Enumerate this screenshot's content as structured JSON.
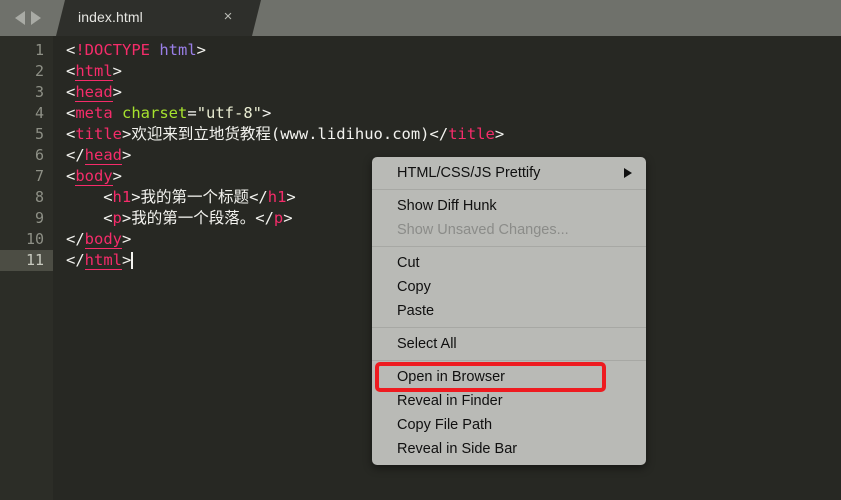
{
  "window": {
    "background_color": "#2b2b28"
  },
  "tabbar": {
    "nav_back_icon": "triangle-left-icon",
    "nav_forward_icon": "triangle-right-icon",
    "tab_title": "index.html",
    "close_icon": "×"
  },
  "editor": {
    "background_color": "#272823",
    "gutter_color": "#2c2d27",
    "active_line": 11,
    "line_numbers": [
      "1",
      "2",
      "3",
      "4",
      "5",
      "6",
      "7",
      "8",
      "9",
      "10",
      "11"
    ],
    "lines": [
      {
        "n": "1",
        "tokens": [
          {
            "t": "<",
            "c": "punc"
          },
          {
            "t": "!DOCTYPE",
            "c": "doct"
          },
          {
            "t": " ",
            "c": "punc"
          },
          {
            "t": "html",
            "c": "kw"
          },
          {
            "t": ">",
            "c": "punc"
          }
        ]
      },
      {
        "n": "2",
        "tokens": [
          {
            "t": "<",
            "c": "punc"
          },
          {
            "t": "html",
            "c": "tag-u"
          },
          {
            "t": ">",
            "c": "punc"
          }
        ]
      },
      {
        "n": "3",
        "tokens": [
          {
            "t": "<",
            "c": "punc"
          },
          {
            "t": "head",
            "c": "tag-u"
          },
          {
            "t": ">",
            "c": "punc"
          }
        ]
      },
      {
        "n": "4",
        "tokens": [
          {
            "t": "<",
            "c": "punc"
          },
          {
            "t": "meta",
            "c": "tag"
          },
          {
            "t": " ",
            "c": "punc"
          },
          {
            "t": "charset",
            "c": "attr"
          },
          {
            "t": "=",
            "c": "punc"
          },
          {
            "t": "\"utf-8\"",
            "c": "str"
          },
          {
            "t": ">",
            "c": "punc"
          }
        ]
      },
      {
        "n": "5",
        "tokens": [
          {
            "t": "<",
            "c": "punc"
          },
          {
            "t": "title",
            "c": "tag"
          },
          {
            "t": ">",
            "c": "punc"
          },
          {
            "t": "欢迎来到立地货教程",
            "c": "text"
          },
          {
            "t": "(www.lidihuo.com)",
            "c": "punc"
          },
          {
            "t": "</",
            "c": "punc"
          },
          {
            "t": "title",
            "c": "tag"
          },
          {
            "t": ">",
            "c": "punc"
          }
        ]
      },
      {
        "n": "6",
        "tokens": [
          {
            "t": "</",
            "c": "punc"
          },
          {
            "t": "head",
            "c": "tag-u"
          },
          {
            "t": ">",
            "c": "punc"
          }
        ]
      },
      {
        "n": "7",
        "tokens": [
          {
            "t": "<",
            "c": "punc"
          },
          {
            "t": "body",
            "c": "tag-u"
          },
          {
            "t": ">",
            "c": "punc"
          }
        ]
      },
      {
        "n": "8",
        "indent": 4,
        "tokens": [
          {
            "t": "<",
            "c": "punc"
          },
          {
            "t": "h1",
            "c": "tag"
          },
          {
            "t": ">",
            "c": "punc"
          },
          {
            "t": "我的第一个标题",
            "c": "text"
          },
          {
            "t": "</",
            "c": "punc"
          },
          {
            "t": "h1",
            "c": "tag"
          },
          {
            "t": ">",
            "c": "punc"
          }
        ]
      },
      {
        "n": "9",
        "indent": 4,
        "tokens": [
          {
            "t": "<",
            "c": "punc"
          },
          {
            "t": "p",
            "c": "tag"
          },
          {
            "t": ">",
            "c": "punc"
          },
          {
            "t": "我的第一个段落。",
            "c": "text"
          },
          {
            "t": "</",
            "c": "punc"
          },
          {
            "t": "p",
            "c": "tag"
          },
          {
            "t": ">",
            "c": "punc"
          }
        ]
      },
      {
        "n": "10",
        "tokens": [
          {
            "t": "</",
            "c": "punc"
          },
          {
            "t": "body",
            "c": "tag-u"
          },
          {
            "t": ">",
            "c": "punc"
          }
        ]
      },
      {
        "n": "11",
        "tokens": [
          {
            "t": "</",
            "c": "punc"
          },
          {
            "t": "html",
            "c": "tag-u"
          },
          {
            "t": ">",
            "c": "punc"
          }
        ]
      }
    ],
    "syntax_colors": {
      "tag": "#f52c6a",
      "doctype_keyword": "#9a7fe8",
      "attribute": "#a6e22e",
      "string": "#e9ecd2",
      "text": "#f3f3ef"
    }
  },
  "context_menu": {
    "groups": [
      {
        "items": [
          {
            "label": "HTML/CSS/JS Prettify",
            "submenu": true,
            "disabled": false
          }
        ]
      },
      {
        "items": [
          {
            "label": "Show Diff Hunk",
            "submenu": false,
            "disabled": false
          },
          {
            "label": "Show Unsaved Changes...",
            "submenu": false,
            "disabled": true
          }
        ]
      },
      {
        "items": [
          {
            "label": "Cut",
            "submenu": false,
            "disabled": false
          },
          {
            "label": "Copy",
            "submenu": false,
            "disabled": false
          },
          {
            "label": "Paste",
            "submenu": false,
            "disabled": false
          }
        ]
      },
      {
        "items": [
          {
            "label": "Select All",
            "submenu": false,
            "disabled": false
          }
        ]
      },
      {
        "items": [
          {
            "label": "Open in Browser",
            "submenu": false,
            "disabled": false,
            "highlighted": true
          },
          {
            "label": "Reveal in Finder",
            "submenu": false,
            "disabled": false
          },
          {
            "label": "Copy File Path",
            "submenu": false,
            "disabled": false
          },
          {
            "label": "Reveal in Side Bar",
            "submenu": false,
            "disabled": false
          }
        ]
      }
    ],
    "highlight_color": "#ee1b20"
  }
}
